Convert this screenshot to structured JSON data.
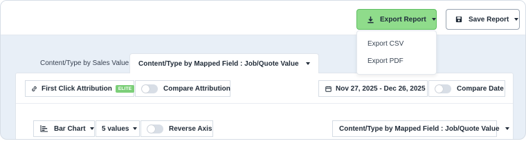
{
  "header": {
    "export_label": "Export Report",
    "export_icon": "download-icon",
    "save_label": "Save Report",
    "save_icon": "floppy-disk-icon",
    "export_color": "#8fdc8b"
  },
  "export_menu": {
    "items": [
      {
        "label": "Export CSV"
      },
      {
        "label": "Export PDF"
      }
    ]
  },
  "tabs": [
    {
      "label": "Content/Type by Sales Value",
      "active": false
    },
    {
      "label": "Content/Type by Mapped Field : Job/Quote Value",
      "active": true
    }
  ],
  "filters": {
    "attribution_label": "First Click Attribution",
    "attribution_badge": "ELITE",
    "compare_attribution_label": "Compare Attribution",
    "date_range_label": "Nov 27, 2025 - Dec 26, 2025",
    "compare_date_label": "Compare Date"
  },
  "chart_controls": {
    "chart_type_label": "Bar Chart",
    "values_label": "5 values",
    "reverse_axis_label": "Reverse Axis",
    "field_select_label": "Content/Type by Mapped Field : Job/Quote Value"
  }
}
